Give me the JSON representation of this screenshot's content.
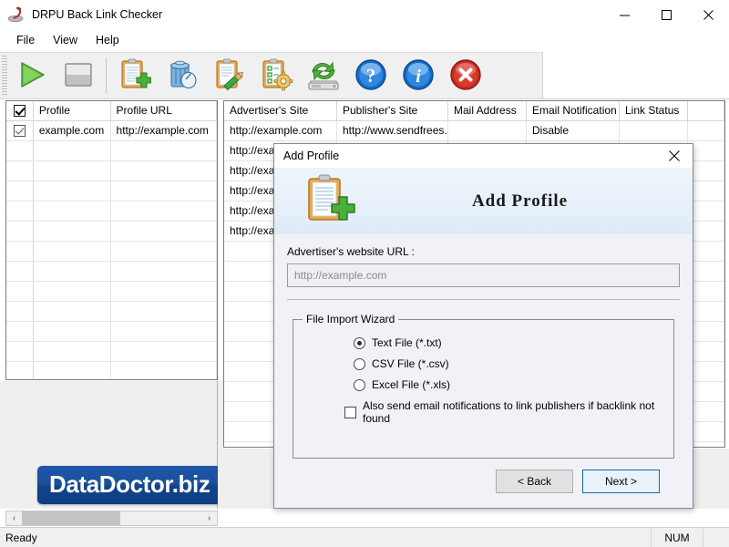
{
  "window": {
    "title": "DRPU Back Link Checker",
    "icon": "app-icon",
    "controls": {
      "minimize": "—",
      "maximize": "☐",
      "close": "✕"
    }
  },
  "menu": {
    "items": [
      "File",
      "View",
      "Help"
    ]
  },
  "toolbar": {
    "buttons": [
      {
        "name": "start-button",
        "icon": "play-icon"
      },
      {
        "name": "stop-button",
        "icon": "stop-icon"
      },
      {
        "name": "add-profile-button",
        "icon": "clipboard-plus-icon"
      },
      {
        "name": "delete-profile-button",
        "icon": "trash-bin-icon"
      },
      {
        "name": "edit-profile-button",
        "icon": "clipboard-pencil-icon"
      },
      {
        "name": "profile-settings-button",
        "icon": "clipboard-gear-icon"
      },
      {
        "name": "backup-restore-button",
        "icon": "refresh-drive-icon"
      },
      {
        "name": "help-button",
        "icon": "help-question-icon"
      },
      {
        "name": "about-button",
        "icon": "info-icon"
      },
      {
        "name": "exit-button",
        "icon": "close-circle-icon"
      }
    ]
  },
  "profile_list": {
    "header_checkbox_checked": true,
    "columns": [
      "Profile",
      "Profile URL"
    ],
    "rows": [
      {
        "checked": true,
        "profile": "example.com",
        "url": "http://example.com"
      }
    ],
    "empty_row_count": 12
  },
  "link_grid": {
    "columns": [
      "Advertiser's Site",
      "Publisher's Site",
      "Mail Address",
      "Email Notification",
      "Link Status"
    ],
    "rows": [
      {
        "advertiser": "http://example.com",
        "publisher": "http://www.sendfrees...",
        "mail": "",
        "notification": "Disable",
        "status": ""
      },
      {
        "advertiser": "http://exa",
        "publisher": "",
        "mail": "",
        "notification": "",
        "status": ""
      },
      {
        "advertiser": "http://exa",
        "publisher": "",
        "mail": "",
        "notification": "",
        "status": ""
      },
      {
        "advertiser": "http://exa",
        "publisher": "",
        "mail": "",
        "notification": "",
        "status": ""
      },
      {
        "advertiser": "http://exa",
        "publisher": "",
        "mail": "",
        "notification": "",
        "status": ""
      },
      {
        "advertiser": "http://exa",
        "publisher": "",
        "mail": "",
        "notification": "",
        "status": ""
      }
    ],
    "empty_row_count": 10
  },
  "branding": {
    "logo_text": "DataDoctor.biz",
    "logo_color": "#14458c"
  },
  "scrollbar": {
    "left_arrow": "‹",
    "right_arrow": "›",
    "thumb_percent": 55
  },
  "statusbar": {
    "message": "Ready",
    "num_indicator": "NUM"
  },
  "dialog": {
    "title": "Add Profile",
    "close_glyph": "✕",
    "banner_icon": "clipboard-plus-icon",
    "banner_title": "Add Profile",
    "url_field": {
      "label": "Advertiser's website URL :",
      "value": "",
      "placeholder": "http://example.com"
    },
    "file_import_wizard": {
      "legend": "File Import Wizard",
      "options": [
        {
          "label": "Text File (*.txt)",
          "selected": true
        },
        {
          "label": "CSV File (*.csv)",
          "selected": false
        },
        {
          "label": "Excel File (*.xls)",
          "selected": false
        }
      ],
      "checkbox": {
        "label": "Also send email notifications to link publishers if backlink not found",
        "checked": false
      }
    },
    "buttons": {
      "back": "< Back",
      "next": "Next >"
    }
  }
}
